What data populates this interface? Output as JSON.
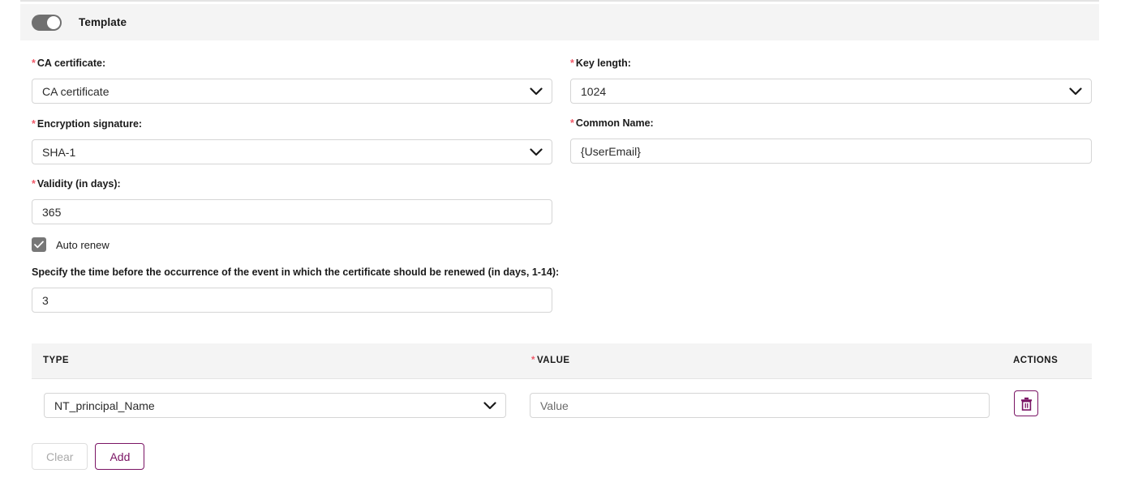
{
  "header": {
    "toggle_state": "on",
    "title": "Template"
  },
  "form": {
    "ca_certificate": {
      "label": "CA certificate:",
      "required": true,
      "value": "CA certificate",
      "control": "select"
    },
    "key_length": {
      "label": "Key length:",
      "required": true,
      "value": "1024",
      "control": "select"
    },
    "encryption_signature": {
      "label": "Encryption signature:",
      "required": true,
      "value": "SHA-1",
      "control": "select"
    },
    "common_name": {
      "label": "Common Name:",
      "required": true,
      "value": "{UserEmail}",
      "control": "text"
    },
    "validity_days": {
      "label": "Validity (in days):",
      "required": true,
      "value": "365",
      "control": "text"
    },
    "auto_renew": {
      "label": "Auto renew",
      "checked": true,
      "check_glyph": "✓"
    },
    "renew_window": {
      "help_text": "Specify the time before the occurrence of the event in which the certificate should be renewed (in days, 1-14):",
      "value": "3",
      "slider_min": 1,
      "slider_max": 14,
      "slider_value": 3
    }
  },
  "table": {
    "columns": [
      {
        "key": "type",
        "label": "TYPE",
        "required": false
      },
      {
        "key": "value",
        "label": "VALUE",
        "required": true
      },
      {
        "key": "actions",
        "label": "ACTIONS",
        "required": false
      }
    ],
    "rows": [
      {
        "type": "NT_principal_Name",
        "value_placeholder": "Value",
        "value": "",
        "action_icon": "trash-icon"
      }
    ]
  },
  "buttons": {
    "clear": {
      "label": "Clear",
      "disabled": true
    },
    "add": {
      "label": "Add",
      "disabled": false
    }
  },
  "icons": {
    "chevron_down": "chevron-down-icon",
    "trash": "trash-icon",
    "check": "check-icon"
  },
  "colors": {
    "accent_purple": "#7a1464",
    "required_red": "#f05a6a",
    "bar_gray": "#f4f4f4",
    "border_gray": "#d5d5d5",
    "slider_fill": "#1c1c1c",
    "slider_track": "#d9d9d9",
    "toggle_on": "#707070",
    "checkbox_fill": "#777777"
  }
}
